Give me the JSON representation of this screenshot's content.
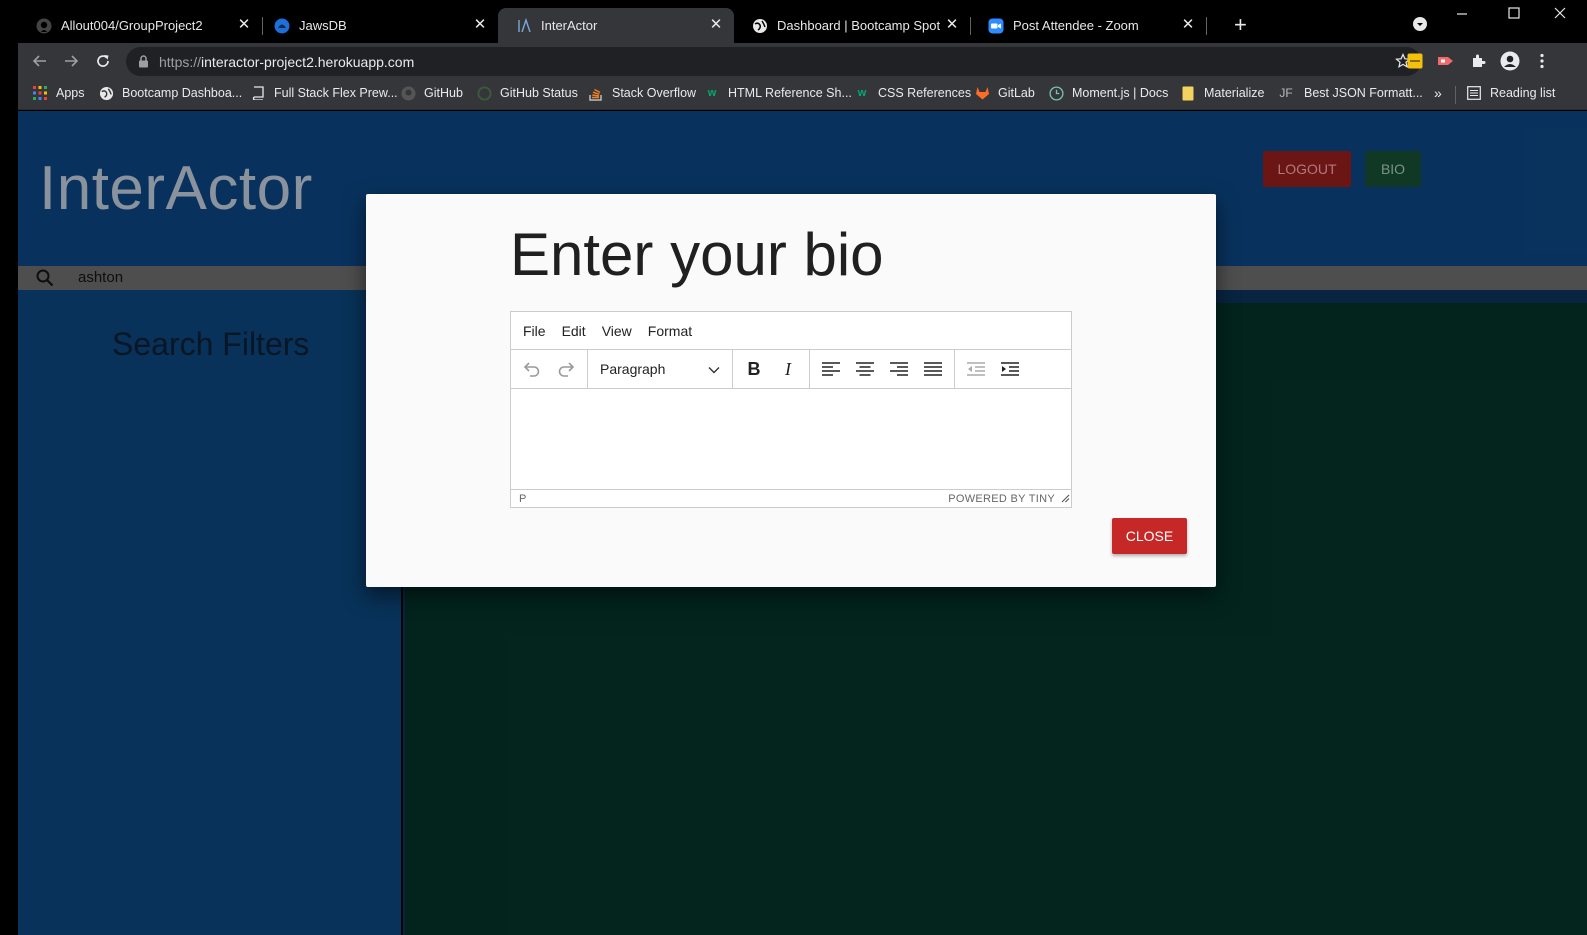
{
  "browser": {
    "tabs": [
      {
        "title": "Allout004/GroupProject2",
        "icon": "github-icon"
      },
      {
        "title": "JawsDB",
        "icon": "jawsdb-icon"
      },
      {
        "title": "InterActor",
        "icon": "interactor-icon",
        "active": true
      },
      {
        "title": "Dashboard | Bootcamp Spot",
        "icon": "globe-icon"
      },
      {
        "title": "Post Attendee - Zoom",
        "icon": "zoom-icon"
      }
    ],
    "url": {
      "scheme": "https://",
      "host": "interactor-project2.herokuapp.com"
    },
    "bookmarks": [
      "Apps",
      "Bootcamp Dashboa...",
      "Full Stack Flex Prew...",
      "GitHub",
      "GitHub Status",
      "Stack Overflow",
      "HTML Reference Sh...",
      "CSS References",
      "GitLab",
      "Moment.js | Docs",
      "Materialize",
      "Best JSON Formatt..."
    ],
    "more_bookmarks": "»",
    "reading_list": "Reading list"
  },
  "page": {
    "brand": "InterActor",
    "logout_label": "LOGOUT",
    "bio_label": "BIO",
    "search_value": "ashton",
    "sidebar_title": "Search Filters"
  },
  "modal": {
    "title": "Enter your bio",
    "menus": [
      "File",
      "Edit",
      "View",
      "Format"
    ],
    "block_format": "Paragraph",
    "status_path": "P",
    "powered_by": "POWERED BY TINY",
    "close_label": "CLOSE"
  },
  "colors": {
    "header": "#0a3a6a",
    "main_panel": "#032a22",
    "logout": "#7a1818",
    "bio": "#13402a",
    "close": "#c62828"
  }
}
